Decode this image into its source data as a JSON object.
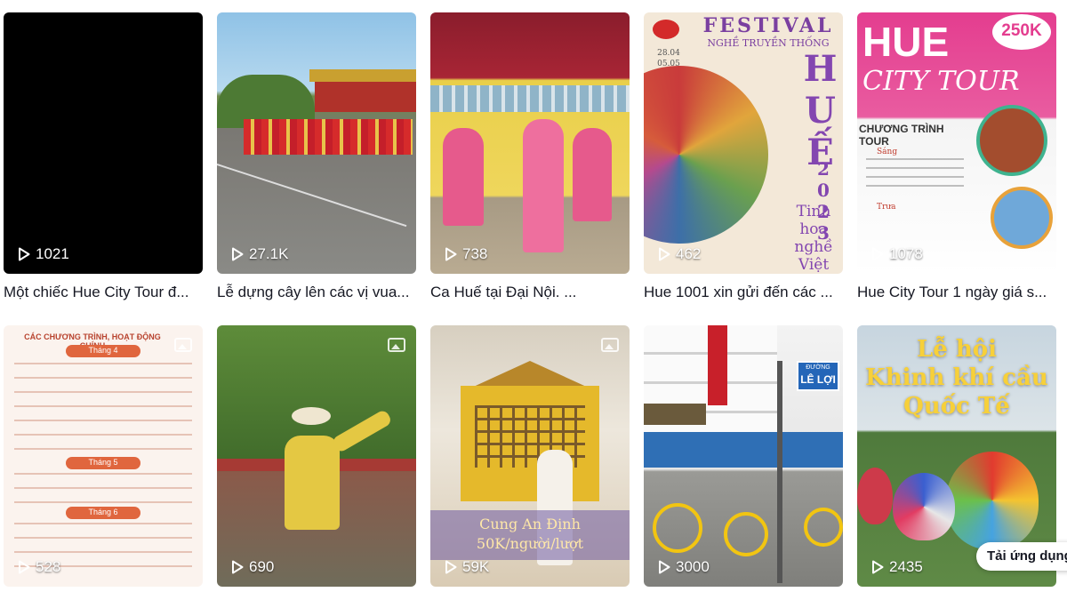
{
  "videos": [
    {
      "views": "1021",
      "caption": "Một chiếc Hue City Tour đ..."
    },
    {
      "views": "27.1K",
      "caption": "Lễ dựng cây lên các vị vua..."
    },
    {
      "views": "738",
      "caption": "Ca Huế tại Đại Nội. ..."
    },
    {
      "views": "462",
      "caption": "Hue 1001 xin gửi đến các ..."
    },
    {
      "views": "1078",
      "caption": "Hue City Tour 1 ngày giá s..."
    },
    {
      "views": "528",
      "caption": ""
    },
    {
      "views": "690",
      "caption": ""
    },
    {
      "views": "59K",
      "caption": ""
    },
    {
      "views": "3000",
      "caption": ""
    },
    {
      "views": "2435",
      "caption": ""
    }
  ],
  "overlays": {
    "festival_title": "FESTIVAL",
    "festival_sub": "NGHỀ TRUYỀN THỐNG",
    "festival_hue": "HUẾ",
    "festival_year": "2023",
    "festival_tagline": "Tinh hoa nghề Việt",
    "festival_dates": "28.04 05.05 2023",
    "citytour_title": "HUE",
    "citytour_script": "CITY TOUR",
    "citytour_price": "250K",
    "citytour_program": "CHƯƠNG TRÌNH TOUR",
    "citytour_morning": "Sáng",
    "citytour_afternoon": "Trưa",
    "program_header": "CÁC CHƯƠNG TRÌNH, HOẠT ĐỘNG CHÍNH",
    "month4": "Tháng 4",
    "month5": "Tháng 5",
    "month6": "Tháng 6",
    "cung_line1": "Cung An Định",
    "cung_line2": "50K/người/lượt",
    "street_sign_top": "ĐƯỜNG",
    "street_sign": "LÊ LỢI",
    "balloon_line1": "Lễ hội",
    "balloon_line2": "Khinh khí cầu",
    "balloon_line3": "Quốc Tế"
  },
  "download_label": "Tải ứng dụng"
}
